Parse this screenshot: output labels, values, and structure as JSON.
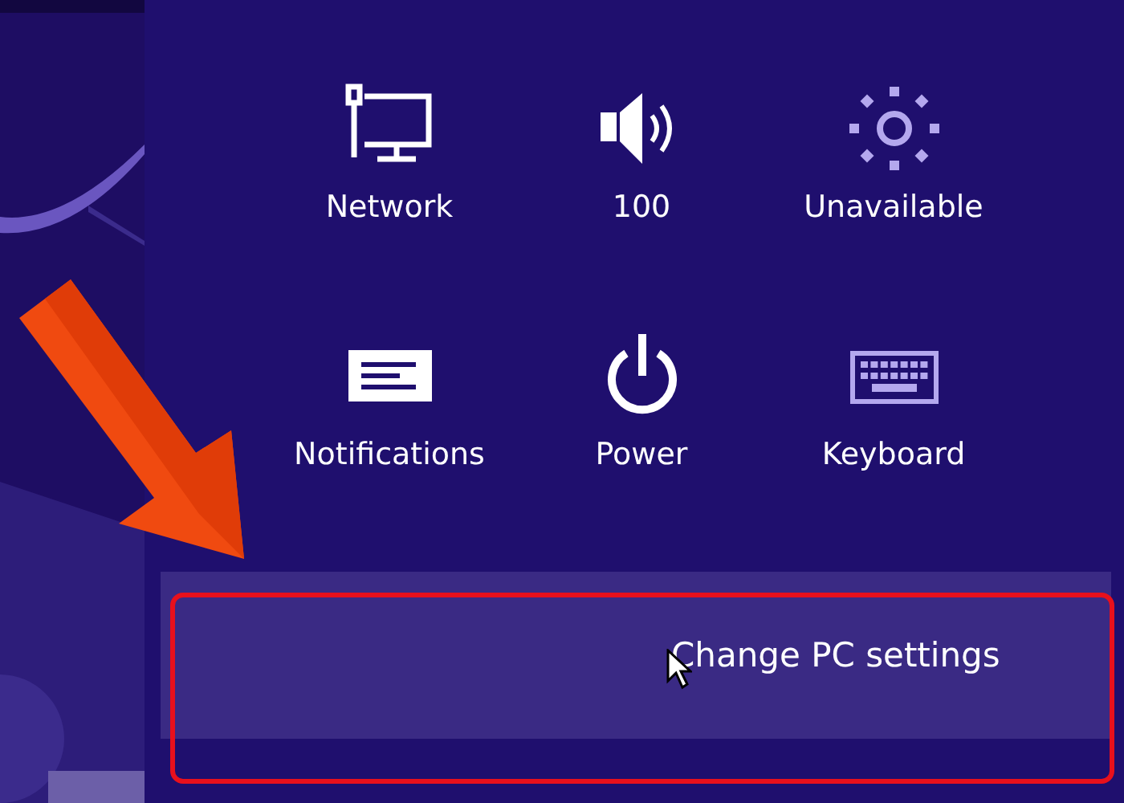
{
  "tiles": [
    {
      "label": "Network",
      "kind": "network",
      "disabled": false
    },
    {
      "label": "100",
      "kind": "volume",
      "disabled": false
    },
    {
      "label": "Unavailable",
      "kind": "brightness",
      "disabled": true
    },
    {
      "label": "Notifications",
      "kind": "notifications",
      "disabled": false
    },
    {
      "label": "Power",
      "kind": "power",
      "disabled": false
    },
    {
      "label": "Keyboard",
      "kind": "keyboard",
      "disabled": true
    }
  ],
  "settings_link": {
    "label": "Change PC settings",
    "selected": true
  }
}
